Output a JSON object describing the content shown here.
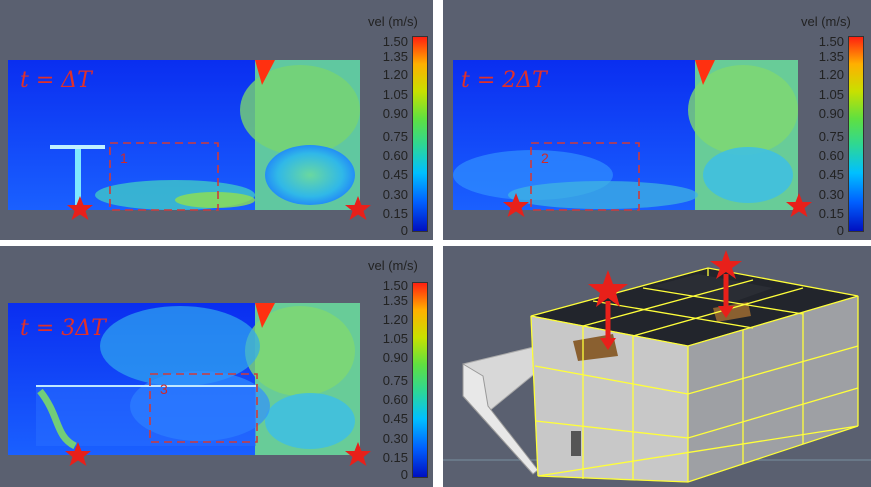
{
  "colorbar": {
    "title": "vel (m/s)",
    "ticks": [
      "1.50",
      "1.35",
      "1.20",
      "1.05",
      "0.90",
      "0.75",
      "0.60",
      "0.45",
      "0.30",
      "0.15",
      "0"
    ]
  },
  "panels": [
    {
      "time_label": "t = ΔT",
      "region_label": "1"
    },
    {
      "time_label": "t = 2ΔT",
      "region_label": "2"
    },
    {
      "time_label": "t = 3ΔT",
      "region_label": "3"
    }
  ],
  "colors": {
    "background_panel": "#5a6070",
    "marker": "#e8201a",
    "box_outline": "#d03a3a",
    "wireframe": "#ffff3a"
  }
}
